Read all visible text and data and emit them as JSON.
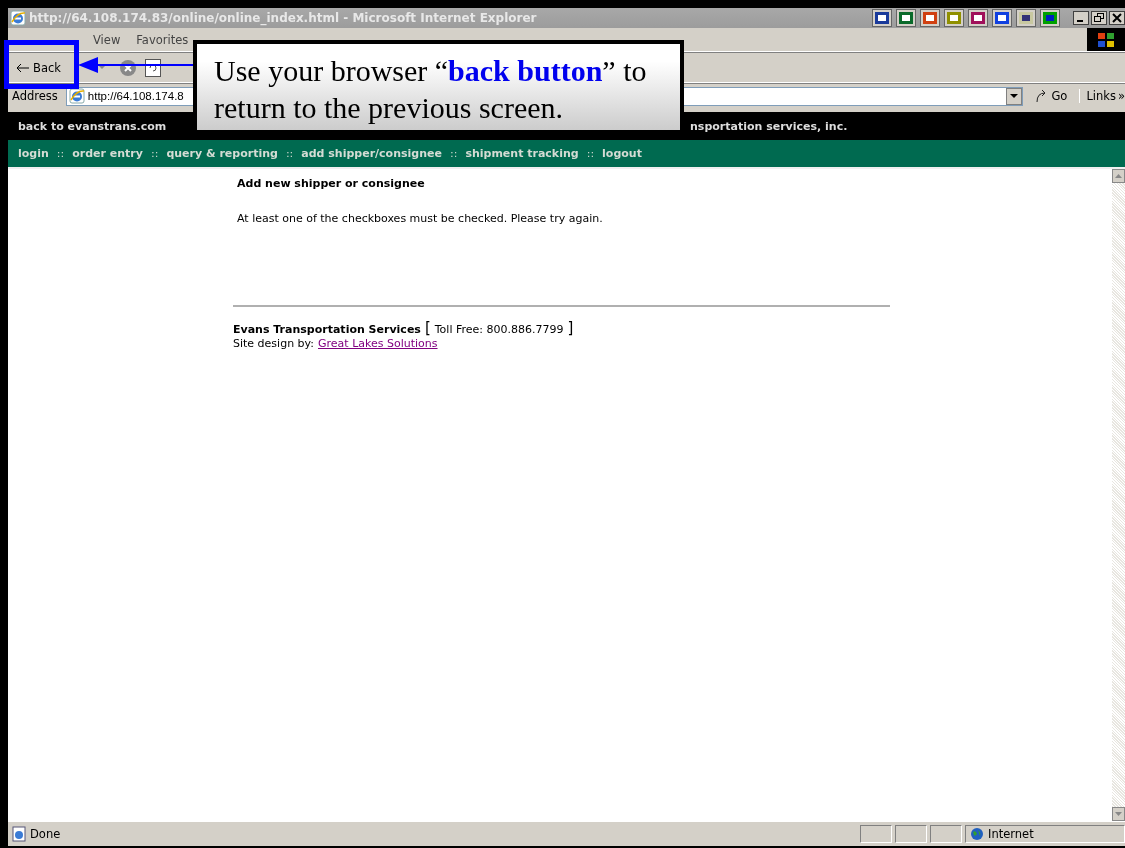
{
  "window": {
    "title": "http://64.108.174.83/online/online_index.html - Microsoft Internet Explorer"
  },
  "menu": [
    "View",
    "Favorites"
  ],
  "toolbar": {
    "back": "Back"
  },
  "address_bar": {
    "label": "Address",
    "value": "http://64.108.174.8",
    "go": "Go",
    "links": "Links",
    "links_more": "»"
  },
  "site_header": {
    "home_link": "back to evanstrans.com",
    "tagline": "nsportation services, inc."
  },
  "nav": {
    "separator": "::",
    "items": [
      {
        "label": "login"
      },
      {
        "label": "order entry"
      },
      {
        "label": "query & reporting"
      },
      {
        "label": "add shipper/consignee"
      },
      {
        "label": "shipment tracking"
      },
      {
        "label": "logout"
      }
    ]
  },
  "content": {
    "heading": "Add new shipper or consignee",
    "message": "At least one of the checkboxes must be checked. Please try again.",
    "footer": {
      "company": "Evans Transportation Services",
      "bracket_open": "[",
      "toll_free": "Toll Free: 800.886.7799",
      "bracket_close": "]",
      "credit_label": "Site design by:",
      "credit_link": "Great Lakes Solutions"
    }
  },
  "status_bar": {
    "status": "Done",
    "zone": "Internet"
  },
  "callout": {
    "text": "Use your browser “**back button**” to return to the previous screen."
  }
}
